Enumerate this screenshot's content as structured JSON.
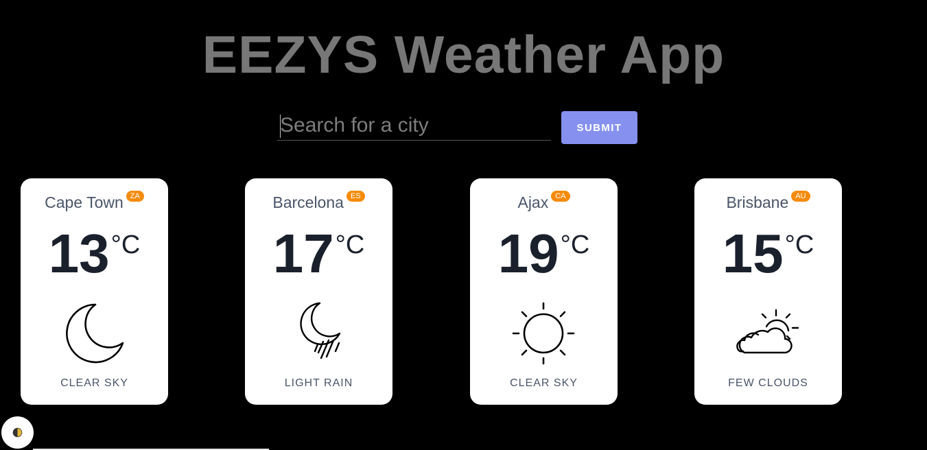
{
  "header": {
    "title": "EEZYS Weather App"
  },
  "search": {
    "placeholder": "Search for a city",
    "value": "",
    "submit_label": "SUBMIT"
  },
  "colors": {
    "background": "#000000",
    "title": "#777777",
    "submit": "#8691ef",
    "badge": "#f58b0a",
    "card": "#ffffff"
  },
  "cards": [
    {
      "city": "Cape Town",
      "country": "ZA",
      "temp": "13",
      "unit": "°C",
      "icon": "moon-icon",
      "description": "CLEAR SKY"
    },
    {
      "city": "Barcelona",
      "country": "ES",
      "temp": "17",
      "unit": "°C",
      "icon": "moon-rain-icon",
      "description": "LIGHT RAIN"
    },
    {
      "city": "Ajax",
      "country": "CA",
      "temp": "19",
      "unit": "°C",
      "icon": "sun-icon",
      "description": "CLEAR SKY"
    },
    {
      "city": "Brisbane",
      "country": "AU",
      "temp": "15",
      "unit": "°C",
      "icon": "sun-cloud-icon",
      "description": "FEW CLOUDS"
    }
  ],
  "theme_toggle": {
    "icon": "half-moon-icon"
  }
}
